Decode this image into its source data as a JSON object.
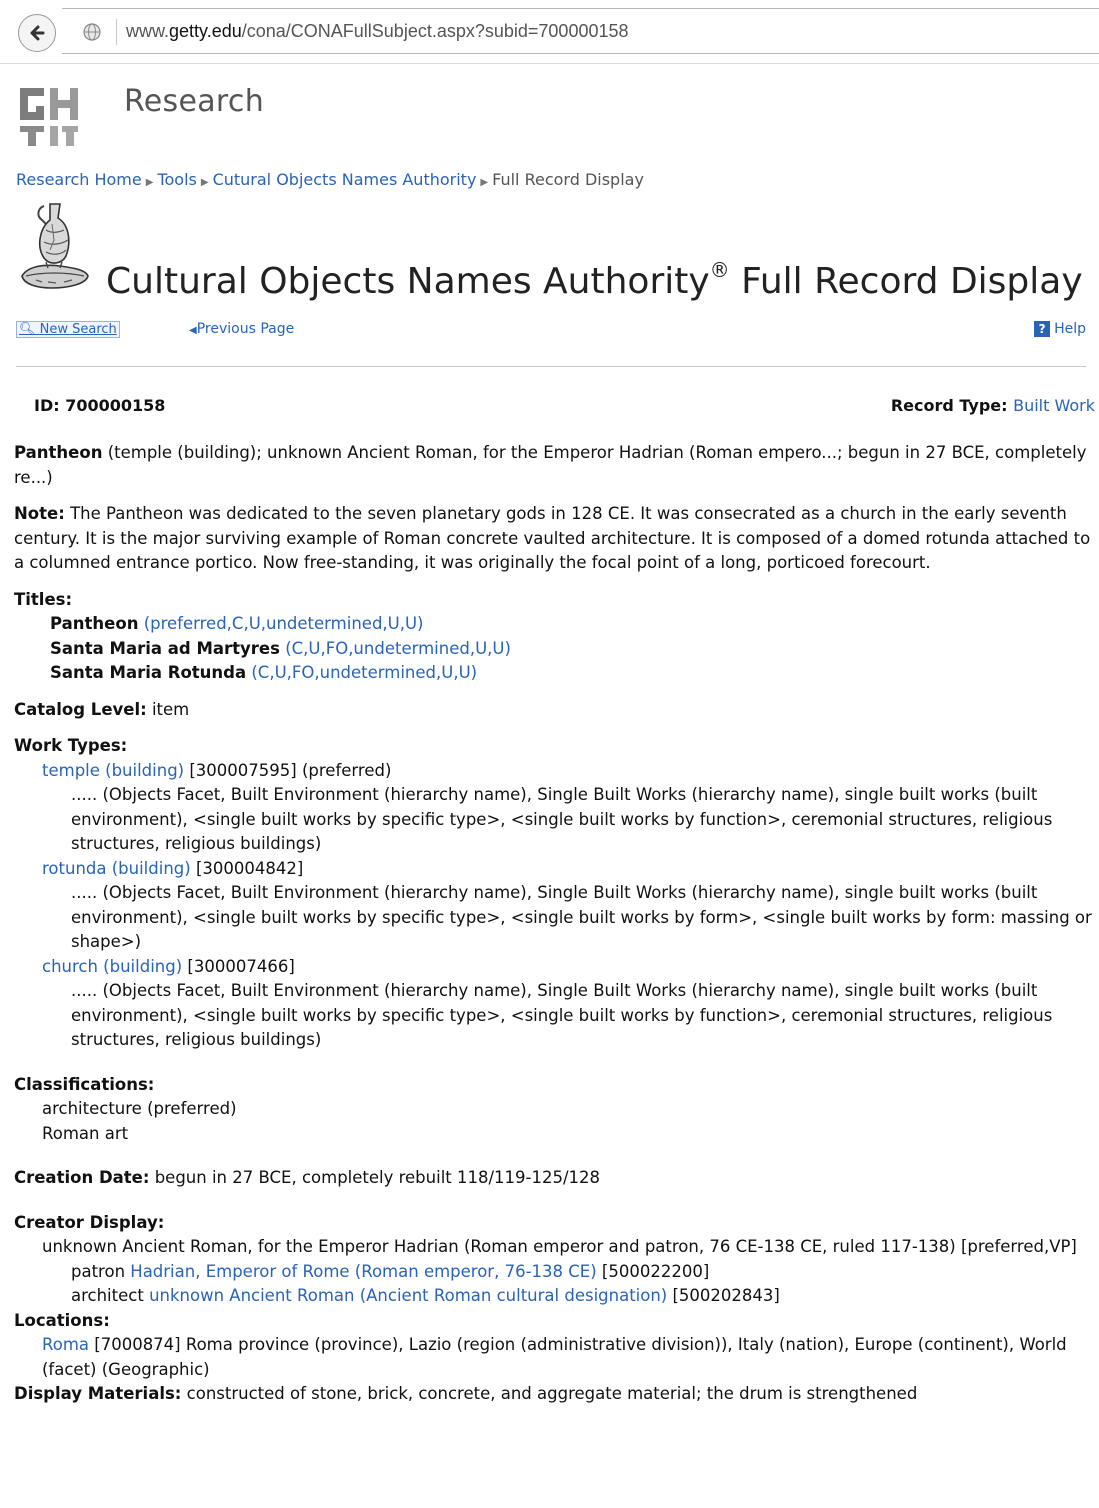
{
  "browser": {
    "url_prefix": "www.",
    "url_domain": "getty.edu",
    "url_path": "/cona/CONAFullSubject.aspx?subid=700000158"
  },
  "header": {
    "section": "Research"
  },
  "breadcrumb": {
    "items": [
      "Research Home",
      "Tools",
      "Cutural Objects Names Authority",
      "Full Record Display"
    ]
  },
  "page": {
    "title": "Cultural Objects Names Authority",
    "reg": "®",
    "title_suffix": " Full Record Display"
  },
  "toolbar": {
    "new_search": "New Search",
    "previous_page": "Previous Page",
    "help": "Help"
  },
  "record": {
    "id_label": "ID: 700000158",
    "type_label": "Record Type:",
    "type_value": "Built Work",
    "summary_name": "Pantheon",
    "summary_rest": " (temple (building); unknown Ancient Roman, for the Emperor Hadrian (Roman empero...; begun in 27 BCE, completely re...)",
    "note_label": "Note:",
    "note_text": " The Pantheon was dedicated to the seven planetary gods in 128 CE. It was consecrated as a church in the early seventh century. It is the major surviving example of Roman concrete vaulted architecture. It is composed of a domed rotunda attached to a columned entrance portico. Now free-standing, it was originally the focal point of a long, porticoed forecourt.",
    "titles_label": "Titles:",
    "titles": [
      {
        "name": "Pantheon",
        "qual": "(preferred,C,U,undetermined,U,U)"
      },
      {
        "name": "Santa Maria ad Martyres",
        "qual": "(C,U,FO,undetermined,U,U)"
      },
      {
        "name": "Santa Maria Rotunda",
        "qual": "(C,U,FO,undetermined,U,U)"
      }
    ],
    "catalog_label": "Catalog Level:",
    "catalog_value": " item",
    "work_types_label": "Work Types:",
    "work_types": [
      {
        "term": "temple (building)",
        "id": " [300007595] (preferred)",
        "hier": "..... (Objects Facet, Built Environment (hierarchy name), Single Built Works (hierarchy name), single built works (built environment), <single built works by specific type>, <single built works by function>, ceremonial structures, religious structures, religious buildings)"
      },
      {
        "term": "rotunda (building)",
        "id": " [300004842]",
        "hier": "..... (Objects Facet, Built Environment (hierarchy name), Single Built Works (hierarchy name), single built works (built environment), <single built works by specific type>, <single built works by form>, <single built works by form: massing or shape>)"
      },
      {
        "term": "church (building)",
        "id": " [300007466]",
        "hier": "..... (Objects Facet, Built Environment (hierarchy name), Single Built Works (hierarchy name), single built works (built environment), <single built works by specific type>, <single built works by function>, ceremonial structures, religious structures, religious buildings)"
      }
    ],
    "classifications_label": "Classifications:",
    "classifications": [
      "architecture (preferred)",
      "Roman art"
    ],
    "creation_label": "Creation Date:",
    "creation_value": " begun in 27 BCE, completely rebuilt 118/119-125/128",
    "creator_label": "Creator Display:",
    "creator_text": "unknown Ancient Roman, for the Emperor Hadrian (Roman emperor and patron, 76 CE-138 CE, ruled 117-138) [preferred,VP]",
    "creators": [
      {
        "role": "patron ",
        "name": "Hadrian, Emperor of Rome (Roman emperor, 76-138 CE)",
        "id": " [500022200]"
      },
      {
        "role": "architect ",
        "name": "unknown Ancient Roman (Ancient Roman cultural designation)",
        "id": " [500202843]"
      }
    ],
    "locations_label": "Locations:",
    "location_link": "Roma",
    "location_text": " [7000874] Roma province (province), Lazio (region (administrative division)), Italy (nation), Europe (continent), World (facet) (Geographic)",
    "materials_label": "Display Materials:",
    "materials_text": " constructed of stone, brick, concrete, and aggregate material; the drum is strengthened"
  }
}
